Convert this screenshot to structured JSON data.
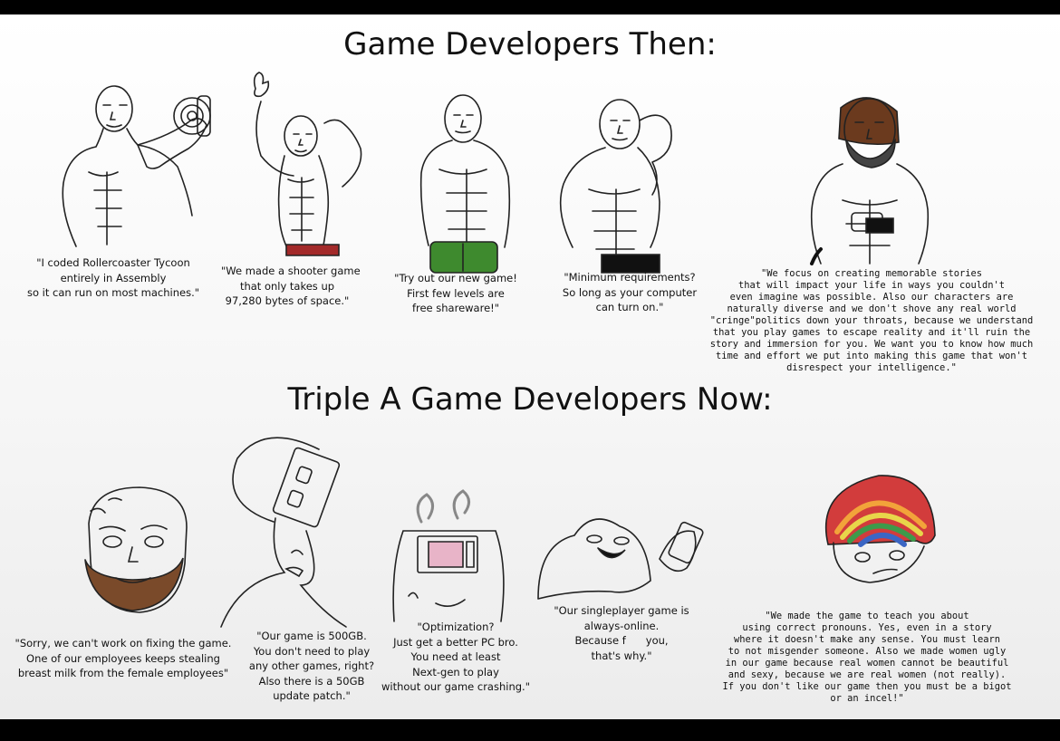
{
  "section_then": {
    "title": "Game Developers Then:",
    "captions": [
      "\"I coded Rollercoaster Tycoon\nentirely in Assembly\nso it can run on most machines.\"",
      "\"We made a shooter game\nthat only takes up\n97,280 bytes of space.\"",
      "\"Try out our new game!\nFirst few levels are\nfree shareware!\"",
      "\"Minimum requirements?\nSo long as your computer\ncan turn on.\"",
      "\"We focus on creating memorable stories\nthat will impact your life in ways you couldn't\neven imagine was possible. Also our characters are\nnaturally diverse and we don't shove any real world\n\"cringe\"politics down your throats, because we understand\nthat you play games to escape reality and it'll ruin the\nstory and immersion for you. We want you to know how much\ntime and effort we put into making this game that won't\ndisrespect your intelligence.\""
    ],
    "figure_icons": [
      "dumbbell-curl-chad-icon",
      "flexing-chad-icon",
      "shirtless-chad-icon",
      "posing-chad-icon",
      "bearded-chad-icon"
    ]
  },
  "section_now": {
    "title": "Triple A Game Developers Now:",
    "captions": [
      "\"Sorry, we can't work on fixing the game.\nOne of our employees keeps stealing\nbreast milk from the female employees\"",
      "\"Our game is 500GB.\nYou don't need to play\nany other games, right?\nAlso there is a 50GB\nupdate patch.\"",
      "\"Optimization?\nJust get a better PC bro.\nYou need at least\nNext-gen to play\nwithout our game crashing.\"",
      "\"Our singleplayer game is\nalways-online.\nBecause f      you,\nthat's why.\"",
      "\"We made the game to teach you about\nusing correct pronouns. Yes, even in a story\nwhere it doesn't make any sense. You must learn\nto not misgender someone. Also we made women ugly\nin our game because real women cannot be beautiful\nand sexy, because we are real women (not really).\nIf you don't like our game then you must be a bigot\nor an incel!\""
    ],
    "figure_icons": [
      "bearded-soyjak-icon",
      "power-strip-soyjak-icon",
      "smoking-computer-soyjak-icon",
      "brainlet-phone-soyjak-icon",
      "rainbow-hair-soyjak-icon"
    ]
  },
  "colors": {
    "background": "#ffffff",
    "frame": "#000000",
    "text": "#111111",
    "shorts_red": "#a32a2a",
    "shorts_green": "#3e8a2e",
    "hair_brown": "#6b3a1e",
    "beard_gray": "#444444"
  }
}
